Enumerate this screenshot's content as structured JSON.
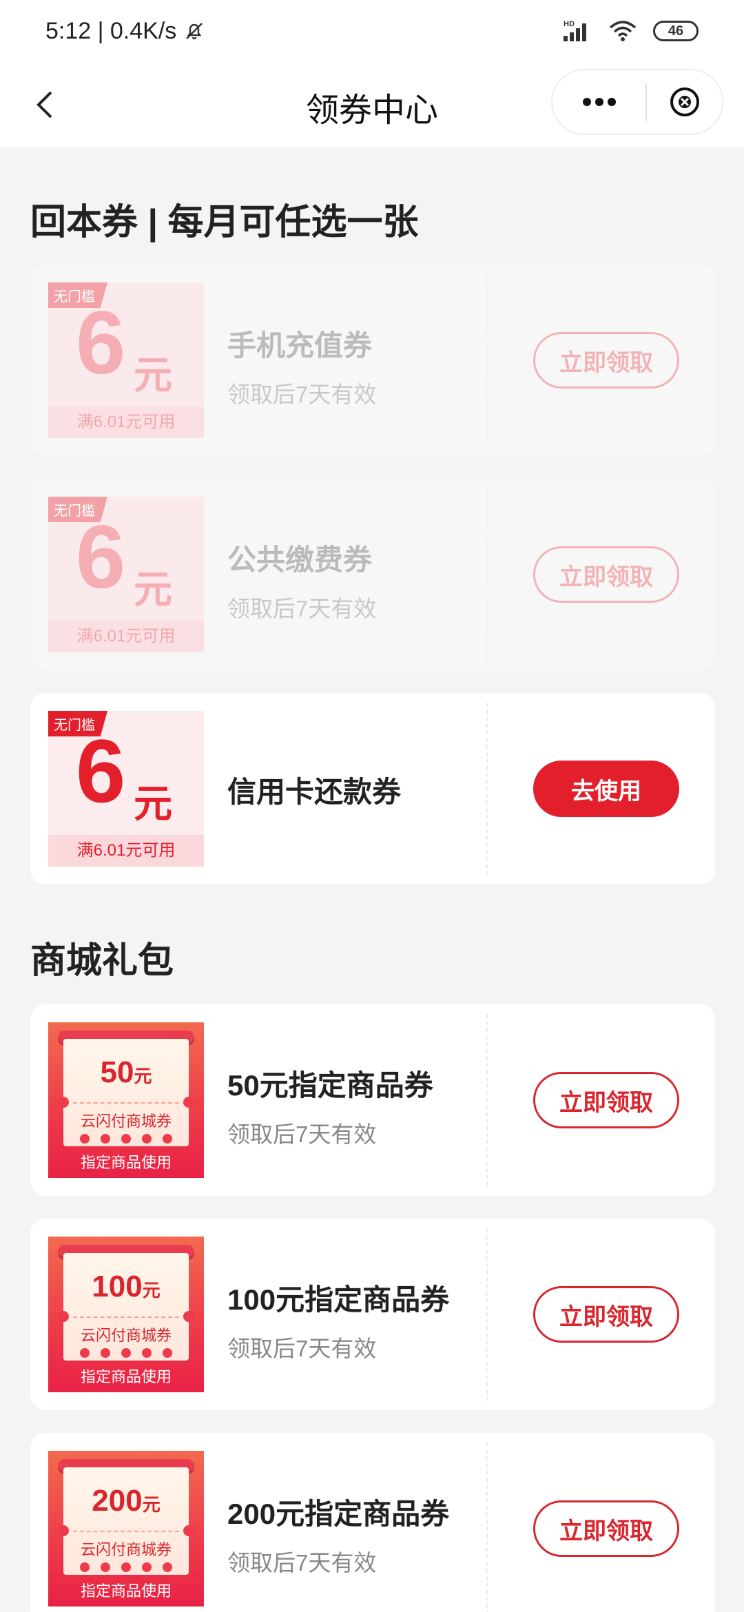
{
  "status_bar": {
    "time_speed": "5:12 | 0.4K/s",
    "network": "HD",
    "battery": "46"
  },
  "nav": {
    "title": "领券中心"
  },
  "sections": {
    "recoup_title": "回本券 | 每月可任选一张",
    "mall_title": "商城礼包"
  },
  "recoup_coupons": [
    {
      "tag": "无门槛",
      "amount": "6",
      "unit": "元",
      "min_spend": "满6.01元可用",
      "name": "手机充值券",
      "validity": "领取后7天有效",
      "button": "立即领取",
      "state": "disabled"
    },
    {
      "tag": "无门槛",
      "amount": "6",
      "unit": "元",
      "min_spend": "满6.01元可用",
      "name": "公共缴费券",
      "validity": "领取后7天有效",
      "button": "立即领取",
      "state": "disabled"
    },
    {
      "tag": "无门槛",
      "amount": "6",
      "unit": "元",
      "min_spend": "满6.01元可用",
      "name": "信用卡还款券",
      "validity": "",
      "button": "去使用",
      "state": "claimed"
    }
  ],
  "mall_coupons": [
    {
      "img_amount": "50",
      "img_unit": "元",
      "img_text": "云闪付商城券",
      "img_footer": "指定商品使用",
      "name": "50元指定商品券",
      "validity": "领取后7天有效",
      "button": "立即领取"
    },
    {
      "img_amount": "100",
      "img_unit": "元",
      "img_text": "云闪付商城券",
      "img_footer": "指定商品使用",
      "name": "100元指定商品券",
      "validity": "领取后7天有效",
      "button": "立即领取"
    },
    {
      "img_amount": "200",
      "img_unit": "元",
      "img_text": "云闪付商城券",
      "img_footer": "指定商品使用",
      "name": "200元指定商品券",
      "validity": "领取后7天有效",
      "button": "立即领取"
    }
  ],
  "colors": {
    "accent": "#e31f2c",
    "background": "#f4f4f4",
    "card": "#ffffff"
  }
}
